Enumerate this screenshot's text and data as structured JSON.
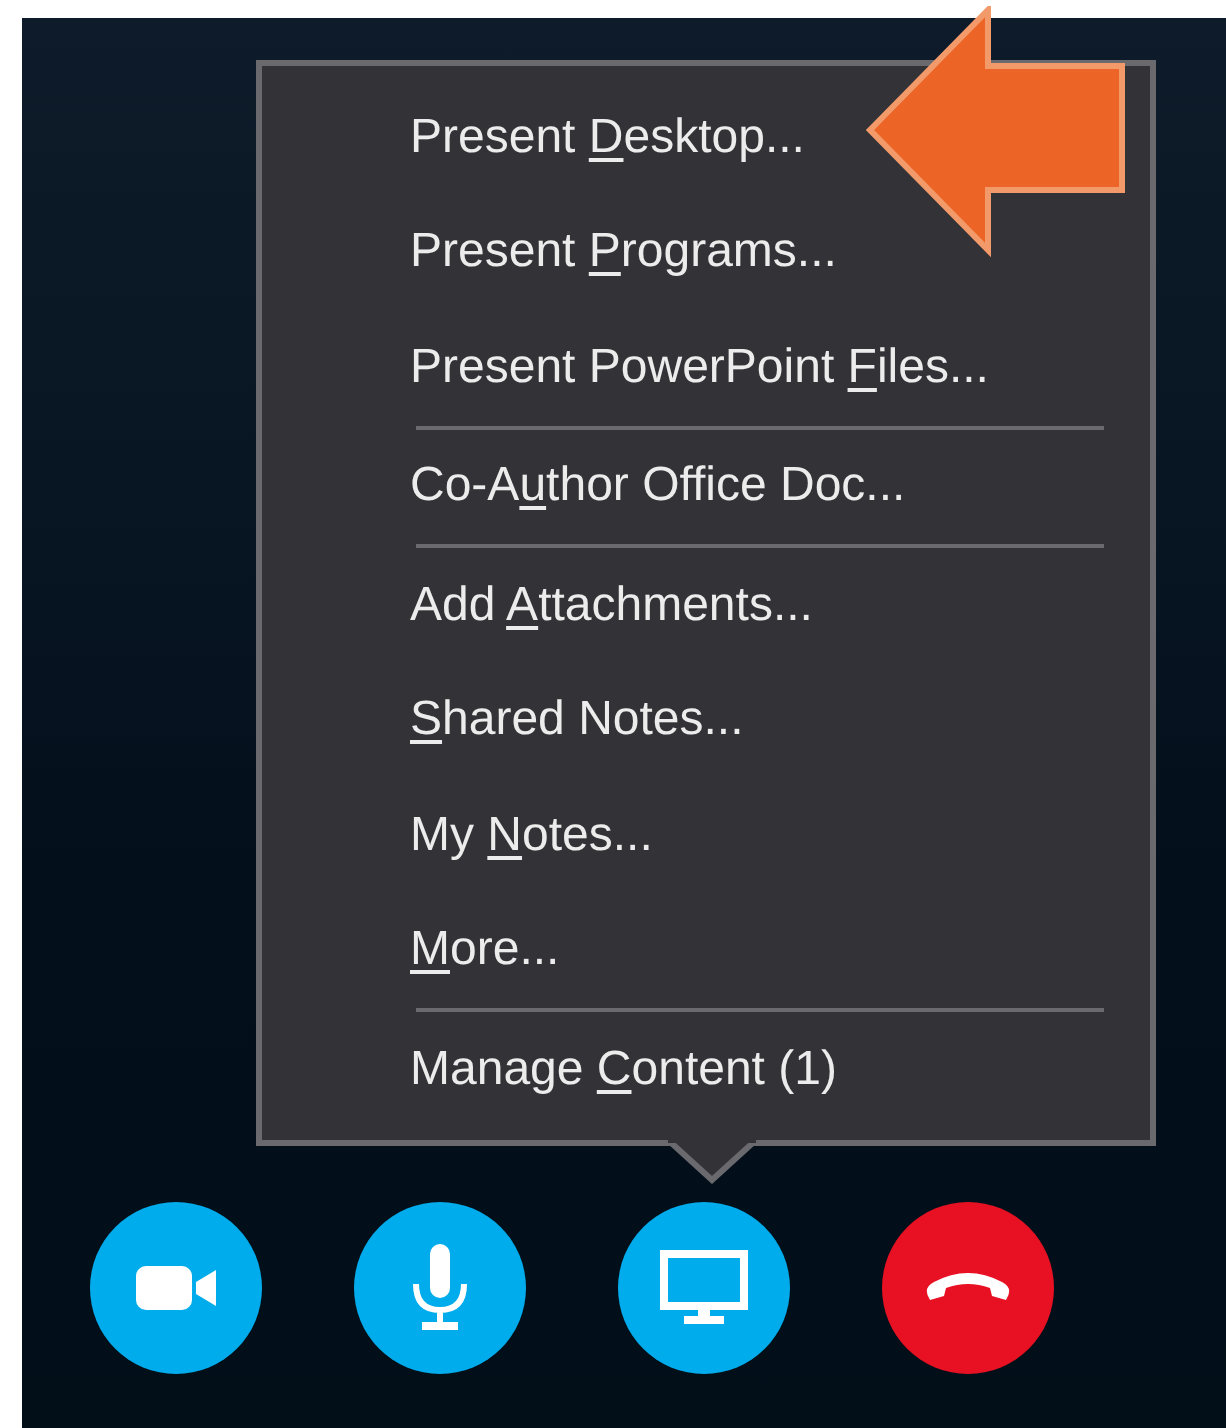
{
  "menu": {
    "items": [
      {
        "kind": "item",
        "before": "Present ",
        "key": "D",
        "after": "esktop..."
      },
      {
        "kind": "item",
        "before": "Present ",
        "key": "P",
        "after": "rograms..."
      },
      {
        "kind": "item",
        "before": "Present PowerPoint ",
        "key": "F",
        "after": "iles..."
      },
      {
        "kind": "separator"
      },
      {
        "kind": "item",
        "before": "Co-A",
        "key": "u",
        "after": "thor Office Doc..."
      },
      {
        "kind": "separator"
      },
      {
        "kind": "item",
        "before": "Add ",
        "key": "A",
        "after": "ttachments..."
      },
      {
        "kind": "item",
        "key": "S",
        "after": "hared Notes..."
      },
      {
        "kind": "item",
        "before": "My ",
        "key": "N",
        "after": "otes..."
      },
      {
        "kind": "item",
        "key": "M",
        "after": "ore..."
      },
      {
        "kind": "separator"
      },
      {
        "kind": "item",
        "before": "Manage ",
        "key": "C",
        "after": "ontent (1)"
      }
    ]
  },
  "call_buttons": [
    {
      "kind": "video"
    },
    {
      "kind": "microphone"
    },
    {
      "kind": "present"
    },
    {
      "kind": "hangup"
    }
  ]
}
